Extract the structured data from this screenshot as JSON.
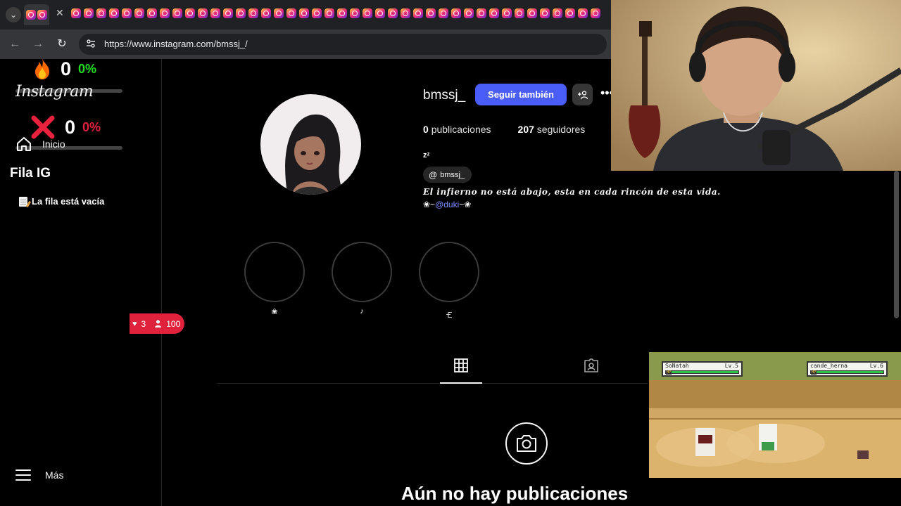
{
  "browser": {
    "url": "https://www.instagram.com/bmssj_/"
  },
  "counters": {
    "first": {
      "value": "0",
      "percent": "0%",
      "percent_color": "#22dd22"
    },
    "second": {
      "value": "0",
      "percent": "0%",
      "percent_color": "#e0223d"
    }
  },
  "sidebar": {
    "logo": "Instagram",
    "home_label": "Inicio",
    "queue_title": "Fila IG",
    "queue_empty": "La fila está vacía",
    "more_label": "Más"
  },
  "live_badge": {
    "likes": "3",
    "viewers": "100"
  },
  "profile": {
    "username": "bmssj_",
    "follow_button": "Seguir también",
    "posts_count": "0",
    "posts_label": "publicaciones",
    "followers_count": "207",
    "followers_label": "seguidores",
    "full_name": "zᶻ",
    "threads_handle": "bmssj_",
    "bio_line1": "𝑬𝒍 𝒊𝒏𝒇𝒊𝒆𝒓𝒏𝒐 𝒏𝒐 𝒆𝒔𝒕á 𝒂𝒃𝒂𝒋𝒐, 𝒆𝒔𝒕𝒂 𝒆𝒏 𝒄𝒂𝒅𝒂 𝒓𝒊𝒏𝒄ó𝒏 𝒅𝒆 𝒆𝒔𝒕𝒂 𝒗𝒊𝒅𝒂.",
    "bio_line2_prefix": "❀~",
    "bio_mention": "@duki",
    "bio_line2_suffix": "~❀",
    "highlights": [
      "❀",
      "♪",
      "🝗"
    ]
  },
  "posts": {
    "empty_title": "Aún no hay publicaciones"
  },
  "game": {
    "player": {
      "name": "SoNatah",
      "level": "Lv.5"
    },
    "opponent": {
      "name": "cande_herna",
      "level": "Lv.6"
    }
  },
  "colors": {
    "follow_button": "#4a5df9",
    "live_badge": "#e0223d",
    "accent_mention": "#7a8cff"
  }
}
